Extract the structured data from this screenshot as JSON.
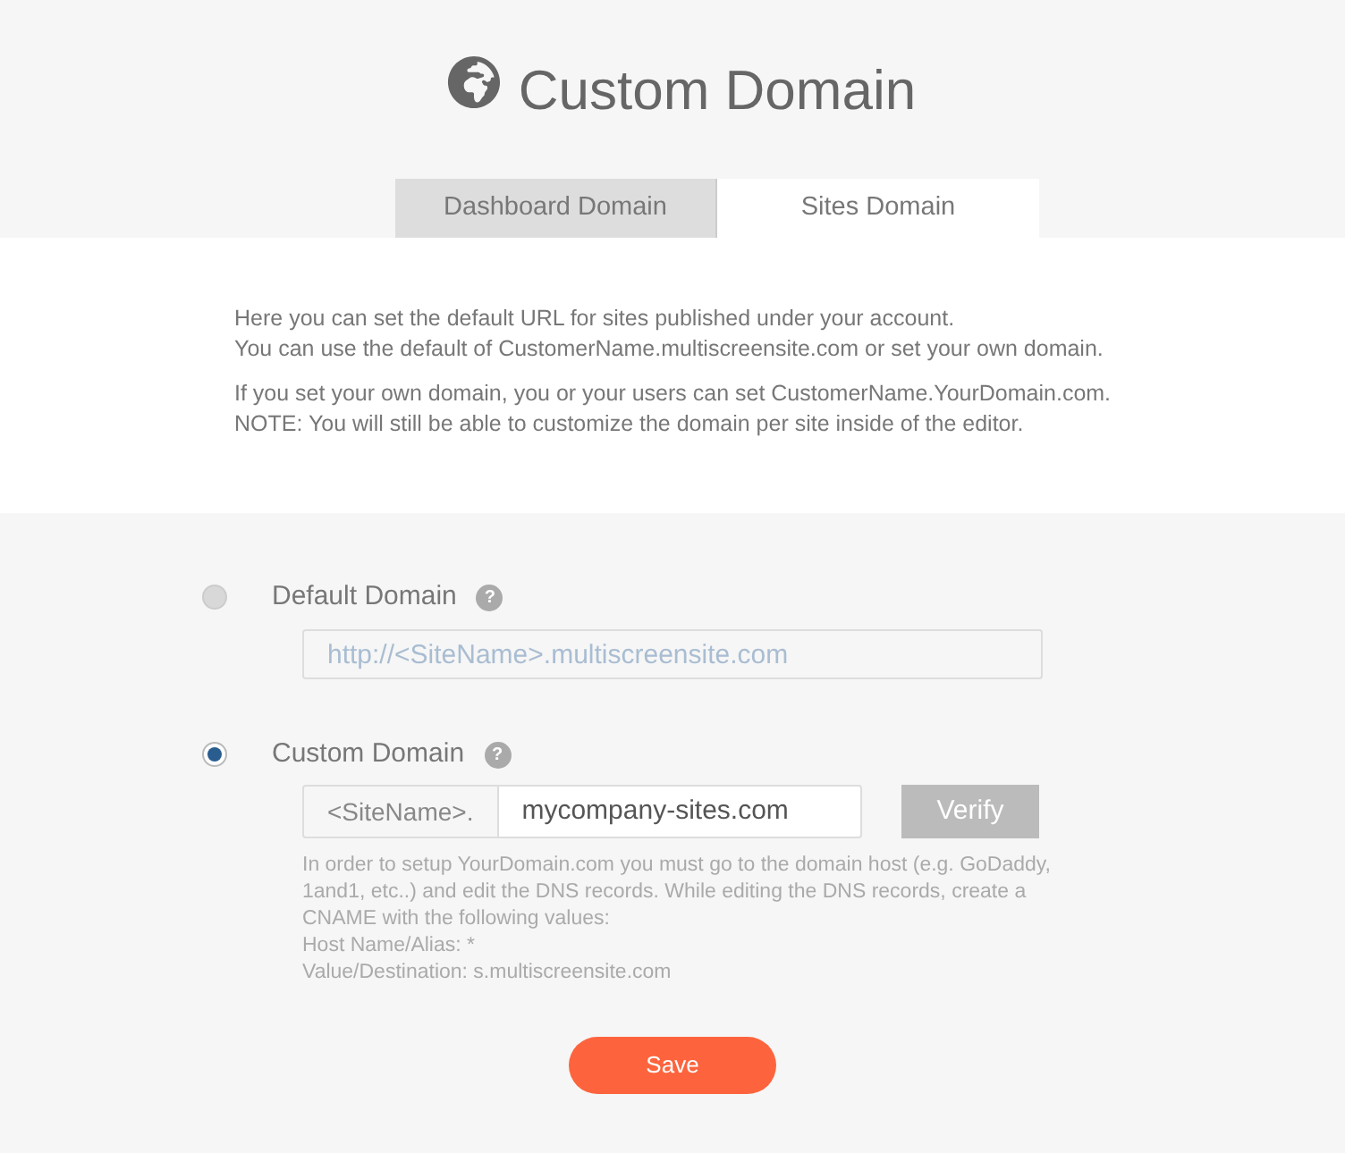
{
  "title": "Custom Domain",
  "tabs": [
    {
      "label": "Dashboard Domain",
      "selected": false
    },
    {
      "label": "Sites Domain",
      "selected": true
    }
  ],
  "intro": [
    "Here you can set the default URL for sites published under your account.\nYou can use the default of CustomerName.multiscreensite.com or set your own domain.",
    "If you set your own domain, you or your users can set CustomerName.YourDomain.com.\nNOTE: You will still be able to customize the domain per site inside of the editor."
  ],
  "options": [
    {
      "kind": "default",
      "label": "Default Domain",
      "help": "?",
      "selected": false,
      "field": {
        "placeholder": "http://<SiteName>.multiscreensite.com"
      }
    },
    {
      "kind": "custom",
      "label": "Custom Domain",
      "help": "?",
      "selected": true,
      "prefix": "<SiteName>.",
      "field": {
        "value": "mycompany-sites.com"
      },
      "button": "Verify",
      "notes": [
        "In order to setup YourDomain.com you must go to the domain host (e.g. GoDaddy, 1and1, etc..) and edit the DNS records. While editing the DNS records, create a CNAME with the following values:",
        "Host Name/Alias: *",
        "Value/Destination: s.multiscreensite.com"
      ]
    }
  ],
  "save_button": "Save"
}
